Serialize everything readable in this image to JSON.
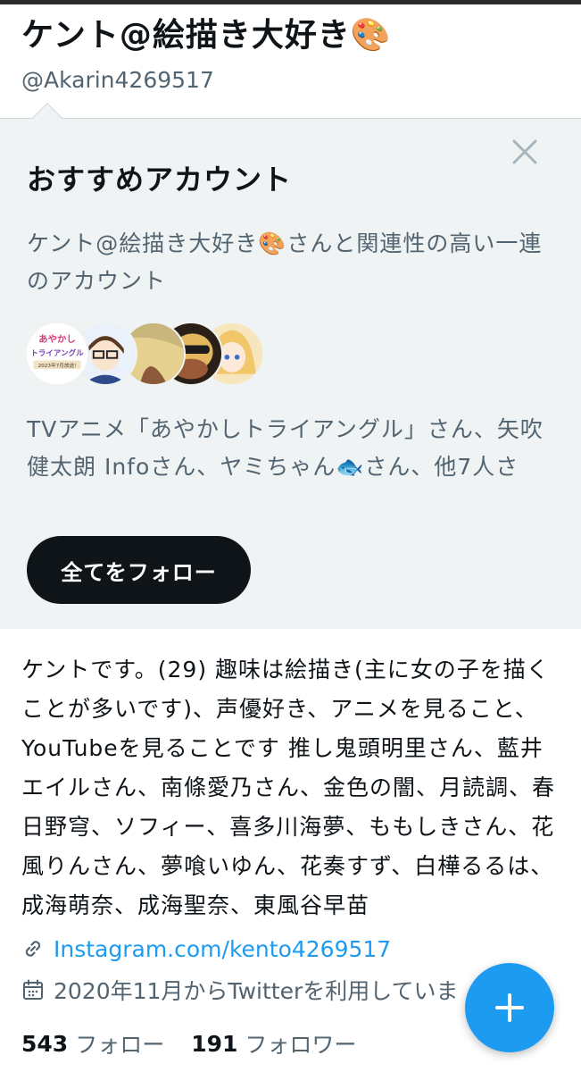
{
  "profile": {
    "name": "ケント@絵描き大好き🎨",
    "handle": "@Akarin4269517"
  },
  "recommendations": {
    "title": "おすすめアカウント",
    "description": "ケント@絵描き大好き🎨さんと関連性の高い一連のアカウント",
    "accounts_text": "TVアニメ「あやかしトライアングル」さん、矢吹健太朗 Infoさん、ヤミちゃん🐟さん、他7人さ",
    "follow_all_label": "全てをフォロー",
    "close_icon": "close-icon",
    "avatar1_text_line1": "あやかし",
    "avatar1_text_line2": "トライアングル",
    "avatar1_text_line3": "2023年7月放送!"
  },
  "bio": {
    "text": "ケントです。(29) 趣味は絵描き(主に女の子を描くことが多いです)、声優好き、アニメを見ること、YouTubeを見ることです 推し鬼頭明里さん、藍井エイルさん、南條愛乃さん、金色の闇、月読調、春日野穹、ソフィー、喜多川海夢、ももしきさん、花風りんさん、夢喰いゆん、花奏すず、白樺るるは、成海萌奈、成海聖奈、東風谷早苗",
    "link": "Instagram.com/kento4269517",
    "joined": "2020年11月からTwitterを利用していま"
  },
  "stats": {
    "following_count": "543",
    "following_label": "フォロー",
    "followers_count": "191",
    "followers_label": "フォロワー"
  },
  "colors": {
    "accent": "#1d9bf0",
    "panel_bg": "#eff3f4",
    "text_primary": "#0f1419",
    "text_secondary": "#536471"
  },
  "icons": {
    "link": "link-icon",
    "calendar": "calendar-icon",
    "compose": "plus-icon"
  }
}
